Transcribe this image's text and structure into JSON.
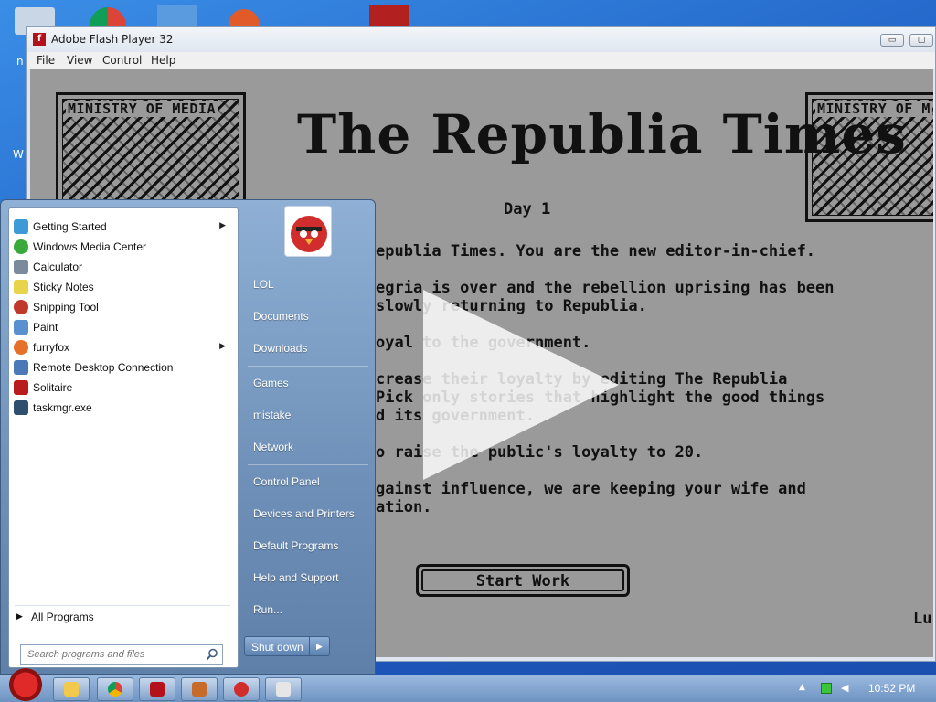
{
  "desktop": {
    "label_w": "W",
    "label_n": "n"
  },
  "flash_window": {
    "title": "Adobe Flash Player 32",
    "app_icon_glyph": "f",
    "minimize_glyph": "▭",
    "maximize_glyph": "▢",
    "menu": [
      "File",
      "View",
      "Control",
      "Help"
    ]
  },
  "game": {
    "ministry_label": "MINISTRY OF MEDIA",
    "ministry_label_right": "MINISTRY OF M",
    "title": "The Republia Times",
    "day": "Day 1",
    "story_lines": [
      "epublia Times. You are the new editor-in-chief.",
      "egria is over and the rebellion uprising has been",
      "slowly returning to Republia.",
      "oyal to the government.",
      "crease their loyalty by editing The Republia",
      "Pick only stories that highlight the good things",
      "d its government.",
      "o raise the public's loyalty to 20.",
      "gainst influence, we are keeping your wife and",
      "ation."
    ],
    "start_button": "Start Work",
    "corner_text": "Lu"
  },
  "start_menu": {
    "programs": [
      {
        "label": "Getting Started",
        "icon": "getting-started-icon",
        "color": "#3c9ad6",
        "arrow": true
      },
      {
        "label": "Windows Media Center",
        "icon": "media-center-icon",
        "color": "#3aa93a",
        "arrow": false
      },
      {
        "label": "Calculator",
        "icon": "calculator-icon",
        "color": "#7b8a9c",
        "arrow": false
      },
      {
        "label": "Sticky Notes",
        "icon": "sticky-notes-icon",
        "color": "#e8d44a",
        "arrow": false
      },
      {
        "label": "Snipping Tool",
        "icon": "scissors-icon",
        "color": "#c0392b",
        "arrow": false
      },
      {
        "label": "Paint",
        "icon": "paint-icon",
        "color": "#5a8fd0",
        "arrow": false
      },
      {
        "label": "furryfox",
        "icon": "firefox-icon",
        "color": "#e4702a",
        "arrow": true
      },
      {
        "label": "Remote Desktop Connection",
        "icon": "remote-desktop-icon",
        "color": "#4b79b8",
        "arrow": false
      },
      {
        "label": "Solitaire",
        "icon": "cards-icon",
        "color": "#b91c1c",
        "arrow": false
      },
      {
        "label": "taskmgr.exe",
        "icon": "task-manager-icon",
        "color": "#2f4f6f",
        "arrow": false
      }
    ],
    "all_programs": "All Programs",
    "search_placeholder": "Search programs and files",
    "places": [
      "LOL",
      "Documents",
      "Downloads",
      "Games",
      "mistake",
      "Network",
      "Control Panel",
      "Devices and Printers",
      "Default Programs",
      "Help and Support",
      "Run..."
    ],
    "shutdown_label": "Shut down",
    "shutdown_arrow": "▶",
    "submenu_arrow": "▶"
  },
  "taskbar": {
    "buttons": [
      {
        "name": "explorer",
        "icon": "folder-icon",
        "color": "#f2c94c"
      },
      {
        "name": "chrome",
        "icon": "chrome-icon",
        "color": "#db4437"
      },
      {
        "name": "flash-player",
        "icon": "flash-icon",
        "color": "#b3121b"
      },
      {
        "name": "game-app",
        "icon": "game-icon",
        "color": "#c76b2b"
      },
      {
        "name": "angry-bird-app",
        "icon": "bird-icon",
        "color": "#d12d2d"
      },
      {
        "name": "cards-app",
        "icon": "cards-icon",
        "color": "#e6e6e6"
      }
    ],
    "clock": "10:52 PM"
  }
}
